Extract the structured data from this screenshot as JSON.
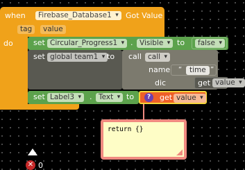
{
  "event_block": {
    "when": "when",
    "component": "Firebase_Database1",
    "event": "Got Value",
    "params": [
      "tag",
      "value"
    ],
    "do": "do"
  },
  "stmt1": {
    "set": "set",
    "component": "Circular_Progress1",
    "sep": ".",
    "property": "Visible",
    "to": "to",
    "value": "false"
  },
  "stmt2": {
    "set": "set",
    "variable": "global team1",
    "to": "to",
    "call": "call",
    "method": "call",
    "arg1_name": "name",
    "arg1_value": "time",
    "arg2_name": "dic",
    "arg2_get": "get",
    "arg2_value": "value"
  },
  "stmt3": {
    "set": "set",
    "component": "Label3",
    "sep": ".",
    "property": "Text",
    "to": "to",
    "help": "?",
    "get": "get",
    "value": "value"
  },
  "comment": {
    "text": "return {}"
  },
  "workspace": {
    "error_count": "0"
  },
  "colors": {
    "event": "#f0a21a",
    "component": "#5ca24c",
    "variable": "#ee5f28",
    "procedure": "#7c7a6e",
    "dark_block": "#595951",
    "comment_bg": "#fefdc6",
    "comment_border": "#f08a80"
  }
}
